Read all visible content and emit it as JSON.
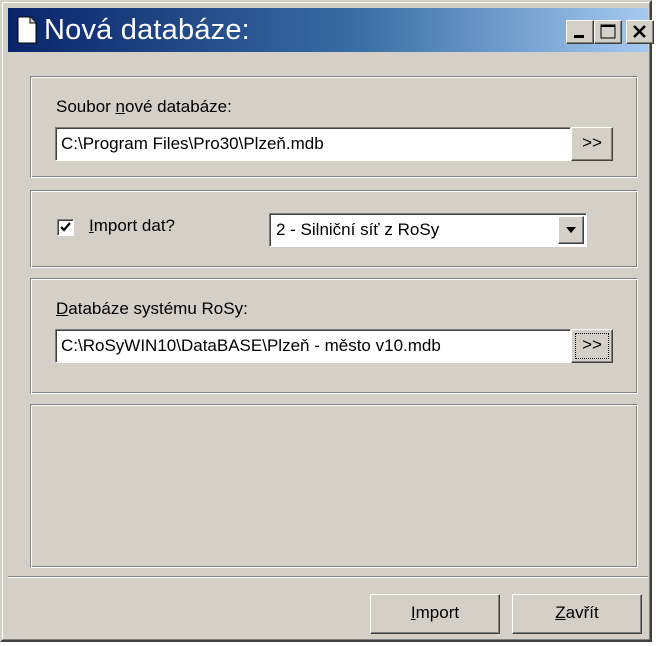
{
  "window": {
    "title": "Nová databáze:"
  },
  "icons": {
    "title": "document-icon",
    "minimize": "minimize-icon",
    "maximize": "maximize-icon",
    "close": "close-icon",
    "combo_arrow": "chevron-down-icon"
  },
  "colors": {
    "titlebar_start": "#0a246a",
    "titlebar_end": "#a6caf0",
    "face": "#d4d0c8"
  },
  "new_db": {
    "label_before": "Soubor ",
    "label_access": "n",
    "label_after": "ové databáze:",
    "path": "C:\\Program Files\\Pro30\\Plzeň.mdb",
    "browse_label": ">>"
  },
  "import": {
    "checked": true,
    "label_access": "I",
    "label_after": "mport dat?",
    "selected": "2 - Silniční síť z RoSy"
  },
  "rosy_db": {
    "label_access": "D",
    "label_after": "atabáze systému RoSy:",
    "path": "C:\\RoSyWIN10\\DataBASE\\Plzeň - město v10.mdb",
    "browse_label": ">>"
  },
  "footer": {
    "import_access": "I",
    "import_rest": "mport",
    "close_access": "Z",
    "close_rest": "avřít"
  }
}
